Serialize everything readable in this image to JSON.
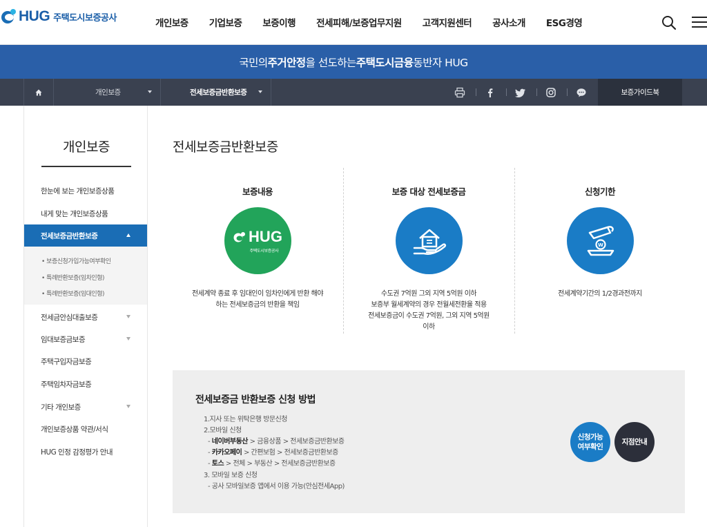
{
  "header": {
    "logo_text": "HUG",
    "logo_sub": "주택도시보증공사",
    "nav": [
      "개인보증",
      "기업보증",
      "보증이행",
      "전세피해/보증업무지원",
      "고객지원센터",
      "공사소개",
      "ESG경영"
    ]
  },
  "banner": {
    "part1": "국민의 ",
    "part2": "주거안정",
    "part3": "을 선도하는 ",
    "part4": "주택도시금융",
    "part5": " 동반자 HUG"
  },
  "location": {
    "level1": "개인보증",
    "level2": "전세보증금반환보증",
    "guide": "보증가이드북"
  },
  "sidebar": {
    "title": "개인보증",
    "items": [
      "한눈에 보는 개인보증상품",
      "내게 맞는 개인보증상품",
      "전세보증금반환보증",
      "전세금안심대출보증",
      "임대보증금보증",
      "주택구입자금보증",
      "주택임차자금보증",
      "기타 개인보증",
      "개인보증상품 약관/서식",
      "HUG 인정 감정평가 안내"
    ],
    "subitems": [
      "• 보증신청가입가능여부확인",
      "• 특례반환보증(임차인형)",
      "• 특례반환보증(임대인형)"
    ]
  },
  "main": {
    "title": "전세보증금반환보증",
    "columns": [
      {
        "title": "보증내용",
        "logo_text": "HUG",
        "logo_sub": "주택도시보증공사",
        "desc": [
          "전세계약 종료 후 임대인이 임차인에게 반환 해야",
          "하는 전세보증금의 반환을 책임"
        ]
      },
      {
        "title": "보증 대상 전세보증금",
        "desc": [
          "수도권 7억원 그외 지역 5억원 이하",
          "보증부 월세계약의 경우 전월세전환율 적용",
          "전세보증금이 수도권 7억원, 그외 지역 5억원",
          "이하"
        ]
      },
      {
        "title": "신청기한",
        "desc": [
          "전세계약기간의 1/2경과전까지"
        ]
      }
    ]
  },
  "howto": {
    "title": "전세보증금 반환보증 신청 방법",
    "step1": "1.지사 또는 위탁은행 방문신청",
    "step2": "2.모바일 신청",
    "naver_name": "네이버부동산",
    "naver_path": " > 금융상품 > 전세보증금반환보증",
    "kakao_name": "카카오페이",
    "kakao_path": " > 간편보험 > 전세보증금반환보증",
    "toss_name": "토스",
    "toss_path": " > 전체 > 부동산 > 전세보증금반환보증",
    "step3": "3. 모바일 보증 신청",
    "step3_detail": "- 공사 모바일보증 앱에서 이용 가능(안심전세App)",
    "dash": "- ",
    "btn_check_1": "신청가능",
    "btn_check_2": "여부확인",
    "btn_branch": "지점안내"
  },
  "colors": {
    "brand_blue": "#1a6db5",
    "banner_blue": "#2a5fa8",
    "locbar": "#3a4150",
    "green": "#22a45a",
    "dark_btn": "#2c2f3a"
  }
}
